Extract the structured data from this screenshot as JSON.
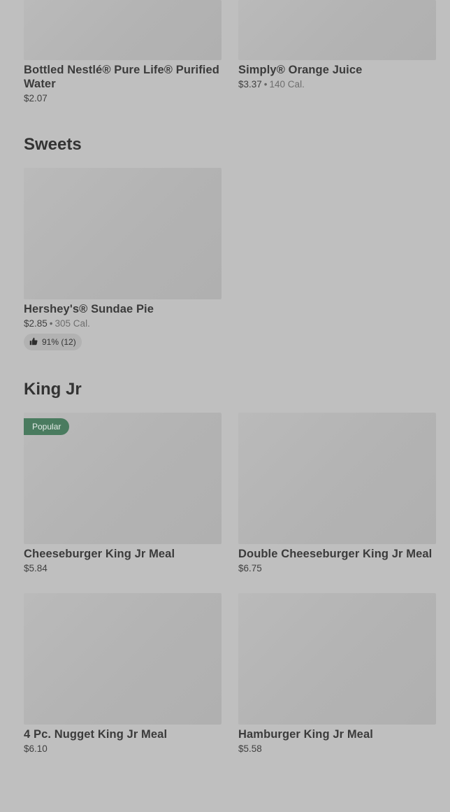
{
  "drinks": [
    {
      "name": "Bottled Nestlé® Pure Life® Purified Water",
      "price": "$2.07"
    },
    {
      "name": "Simply® Orange Juice",
      "price": "$3.37",
      "sep": "•",
      "cal": "140 Cal."
    }
  ],
  "sweets": {
    "title": "Sweets",
    "items": [
      {
        "name": "Hershey's® Sundae Pie",
        "price": "$2.85",
        "sep": "•",
        "cal": "305 Cal.",
        "rating": "91% (12)"
      }
    ]
  },
  "kingjr": {
    "title": "King Jr",
    "items": [
      {
        "name": "Cheeseburger King Jr Meal",
        "price": "$5.84",
        "badge": "Popular"
      },
      {
        "name": "Double Cheeseburger King Jr Meal",
        "price": "$6.75"
      },
      {
        "name": "4 Pc. Nugget King Jr Meal",
        "price": "$6.10"
      },
      {
        "name": "Hamburger King Jr Meal",
        "price": "$5.58"
      }
    ]
  }
}
